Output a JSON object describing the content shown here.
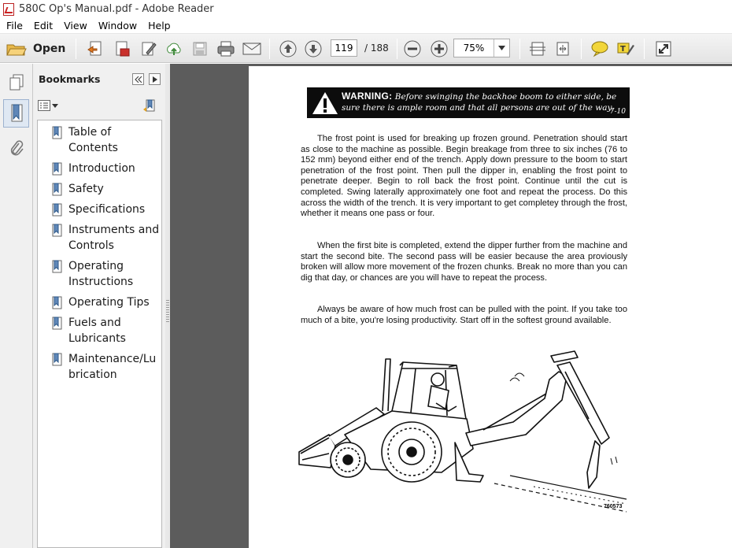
{
  "window": {
    "title": "580C Op's Manual.pdf - Adobe Reader"
  },
  "menu": {
    "items": [
      "File",
      "Edit",
      "View",
      "Window",
      "Help"
    ]
  },
  "toolbar": {
    "open_label": "Open",
    "current_page": "119",
    "page_total": "/ 188",
    "zoom": "75%",
    "icons": [
      "open-folder-icon",
      "create-pdf-icon",
      "export-icon",
      "sign-icon",
      "cloud-upload-icon",
      "save-icon",
      "print-icon",
      "email-icon",
      "previous-page-icon",
      "next-page-icon",
      "zoom-out-icon",
      "zoom-in-icon",
      "fit-page-icon",
      "fit-width-icon",
      "comment-icon",
      "highlight-icon",
      "expand-icon"
    ]
  },
  "bookmarks": {
    "title": "Bookmarks",
    "items": [
      {
        "label": "Table of Contents"
      },
      {
        "label": "Introduction"
      },
      {
        "label": "Safety"
      },
      {
        "label": "Specifications"
      },
      {
        "label": "Instruments and Controls"
      },
      {
        "label": "Operating Instructions"
      },
      {
        "label": "Operating Tips"
      },
      {
        "label": "Fuels and Lubricants"
      },
      {
        "label": "Maintenance/Lubrication"
      }
    ]
  },
  "document": {
    "warning": {
      "heading": "WARNING:",
      "text": "Before swinging the backhoe boom to either side, be sure there is ample room and that all persons are out of the way.",
      "code": "7-10"
    },
    "paragraphs": [
      "The frost point is used for breaking up frozen ground. Penetration should start as close to the machine as possible. Begin breakage from three to six inches (76 to 152 mm) beyond either end of the trench. Apply down pressure to the boom to start penetration of the frost point. Then pull the dipper in, enabling the frost point to penetrate deeper. Begin to roll back the frost point. Continue until the cut is completed. Swing laterally approximately one foot and repeat the process. Do this across the width of the trench. It is very important to get completey through the frost, whether it means one pass or four.",
      "When the first bite is completed, extend the dipper further from the machine and start the second bite. The second pass will be easier because the area proviously broken will allow more movement of the frozen chunks. Break no more than you can dig that day, or chances are you will have to repeat the process.",
      "Always be aware of how much frost can be pulled with the point. If you take too much of a bite, you're losing productivity. Start off in the softest ground available."
    ],
    "figure_code": "760573"
  },
  "colors": {
    "doc_background": "#5c5c5c",
    "panel_background": "#f0f0f0",
    "warning_background": "#0c0c0c"
  }
}
